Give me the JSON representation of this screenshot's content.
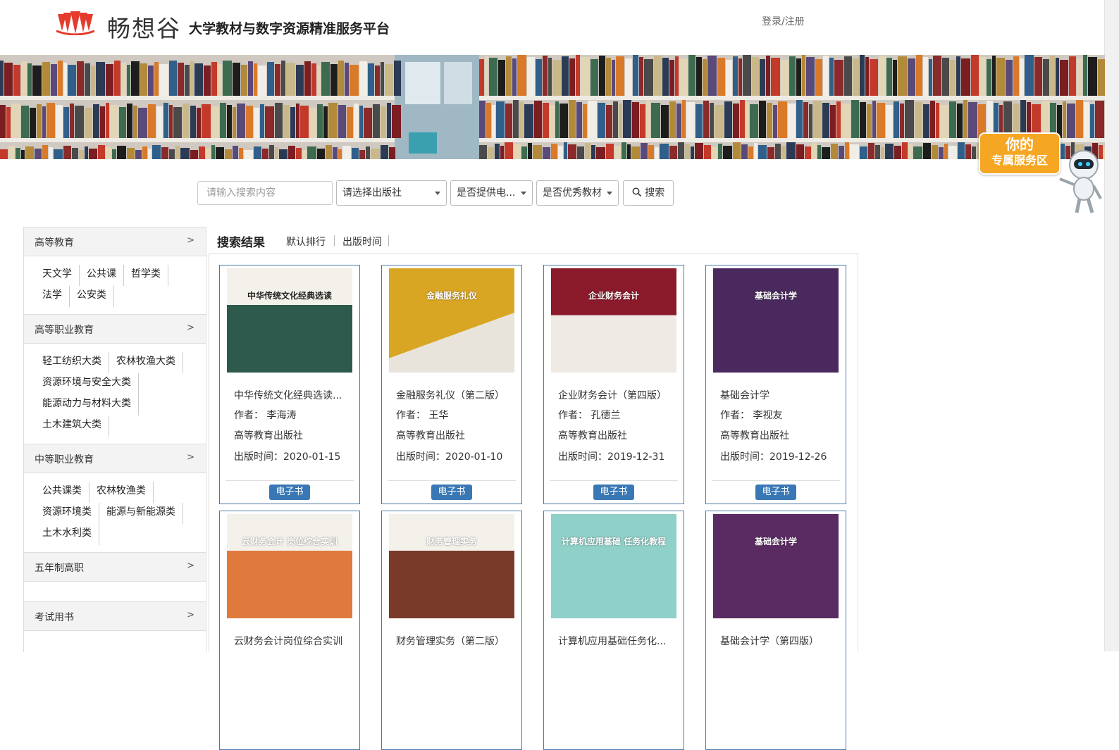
{
  "header": {
    "brand_name": "畅想谷",
    "tagline": "大学教材与数字资源精准服务平台",
    "login": "登录/注册"
  },
  "service_badge": {
    "line1": "你的",
    "line2": "专属服务区"
  },
  "search": {
    "placeholder": "请输入搜索内容",
    "publisher_select": "请选择出版社",
    "ebook_select": "是否提供电...",
    "quality_select": "是否优秀教材",
    "button": "搜索"
  },
  "sidebar": {
    "categories": [
      {
        "name": "高等教育",
        "arrow": ">",
        "rows": [
          [
            "天文学",
            "公共课",
            "哲学类"
          ],
          [
            "法学",
            "公安类"
          ]
        ]
      },
      {
        "name": "高等职业教育",
        "arrow": ">",
        "rows": [
          [
            "轻工纺织大类",
            "农林牧渔大类"
          ],
          [
            "资源环境与安全大类"
          ],
          [
            "能源动力与材料大类"
          ],
          [
            "土木建筑大类"
          ]
        ]
      },
      {
        "name": "中等职业教育",
        "arrow": ">",
        "rows": [
          [
            "公共课类",
            "农林牧渔类"
          ],
          [
            "资源环境类",
            "能源与新能源类"
          ],
          [
            "土木水利类"
          ]
        ]
      },
      {
        "name": "五年制高职",
        "arrow": ">",
        "rows": []
      },
      {
        "name": "考试用书",
        "arrow": ">",
        "rows": []
      }
    ]
  },
  "results": {
    "heading": "搜索结果",
    "sort_default": "默认排行",
    "sort_date": "出版时间",
    "ebook_label": "电子书",
    "books": [
      {
        "title": "中华传统文化经典选读...",
        "author": "作者： 李海涛",
        "publisher": "高等教育出版社",
        "date": "出版时间：2020-01-15",
        "cover_color": "#2e5a4e",
        "cover_title": "中华传统文化经典选读"
      },
      {
        "title": "金融服务礼仪（第二版）",
        "author": "作者： 王华",
        "publisher": "高等教育出版社",
        "date": "出版时间：2020-01-10",
        "cover_color": "#d9a623",
        "cover_title": "金融服务礼仪"
      },
      {
        "title": "企业财务会计（第四版）",
        "author": "作者： 孔德兰",
        "publisher": "高等教育出版社",
        "date": "出版时间：2019-12-31",
        "cover_color": "#8b1a2b",
        "cover_title": "企业财务会计"
      },
      {
        "title": "基础会计学",
        "author": "作者： 李视友",
        "publisher": "高等教育出版社",
        "date": "出版时间：2019-12-26",
        "cover_color": "#4a2a5e",
        "cover_title": "基础会计学"
      },
      {
        "title": "云财务会计岗位综合实训",
        "cover_color": "#e07a3c",
        "cover_title": "云财务会计 岗位综合实训"
      },
      {
        "title": "财务管理实务（第二版）",
        "cover_color": "#7a3a2a",
        "cover_title": "财务管理实务"
      },
      {
        "title": "计算机应用基础任务化...",
        "cover_color": "#8fd0c8",
        "cover_title": "计算机应用基础 任务化教程"
      },
      {
        "title": "基础会计学（第四版）",
        "cover_color": "#5a2a62",
        "cover_title": "基础会计学"
      }
    ]
  }
}
